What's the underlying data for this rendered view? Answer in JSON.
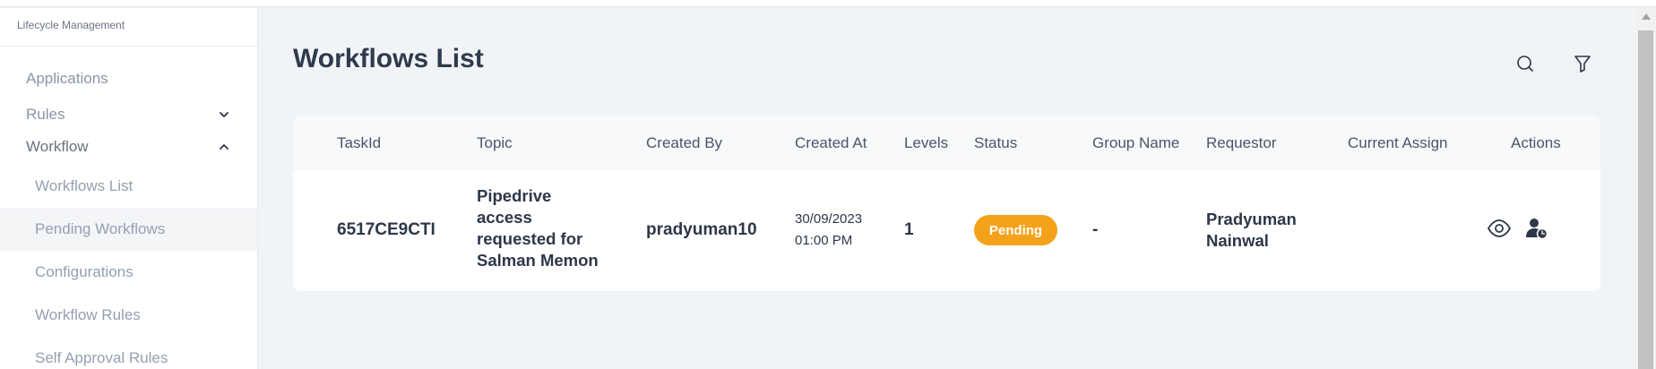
{
  "sidebar": {
    "header": "Lifecycle Management",
    "nav": [
      {
        "label": "Applications"
      },
      {
        "label": "Rules",
        "icon": "chevron-down-icon"
      },
      {
        "label": "Workflow",
        "icon": "chevron-up-icon"
      }
    ],
    "workflow_items": [
      {
        "label": "Workflows List"
      },
      {
        "label": "Pending Workflows",
        "selected": true
      },
      {
        "label": "Configurations"
      },
      {
        "label": "Workflow Rules"
      },
      {
        "label": "Self Approval Rules"
      }
    ]
  },
  "main": {
    "title": "Workflows List",
    "toolbar_icons": [
      "search-icon",
      "filter-icon"
    ]
  },
  "table": {
    "columns": [
      "TaskId",
      "Topic",
      "Created By",
      "Created At",
      "Levels",
      "Status",
      "Group Name",
      "Requestor",
      "Current Assign",
      "Actions"
    ],
    "rows": [
      {
        "task_id": "6517CE9CTI",
        "topic": [
          "Pipedrive",
          "access",
          "requested for",
          "Salman Memon"
        ],
        "created_by": "pradyuman10",
        "created_date": "30/09/2023",
        "created_time": "01:00 PM",
        "levels": "1",
        "status": "Pending",
        "group_name": "-",
        "requestor": [
          "Pradyuman",
          "Nainwal"
        ],
        "current_assign": "",
        "actions": [
          "eye-icon",
          "user-assign-icon"
        ]
      }
    ]
  },
  "colors": {
    "status_pending": "#f5a21b",
    "title_text": "#2f3a4c",
    "page_background": "#f1f4f7"
  }
}
